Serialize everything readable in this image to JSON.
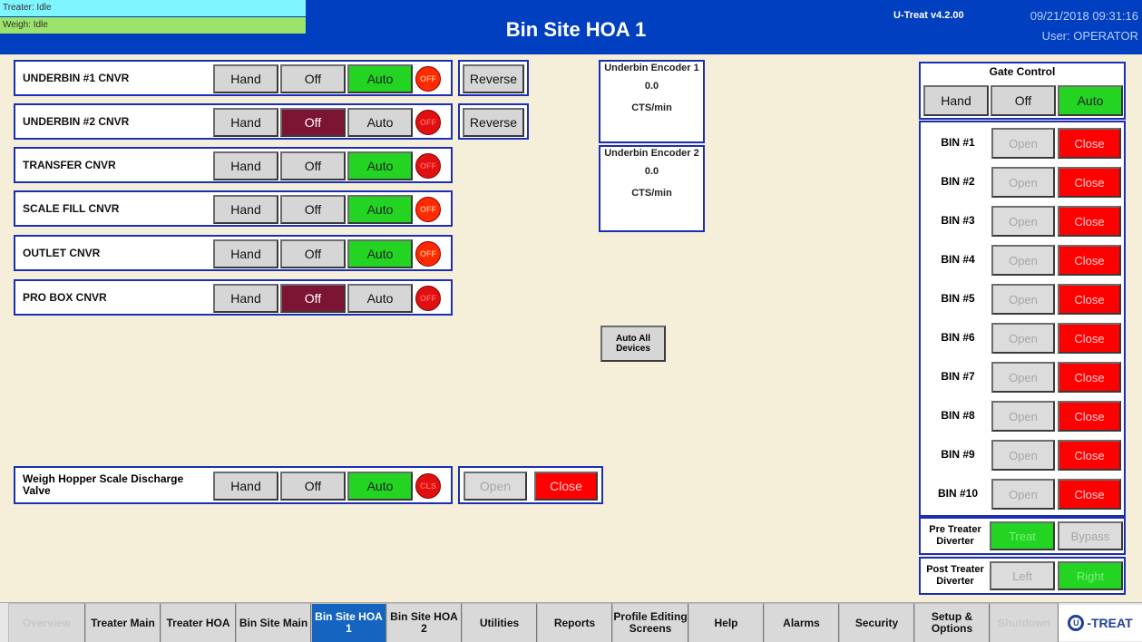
{
  "header": {
    "treater_status": "Treater: Idle",
    "weigh_status": "Weigh: Idle",
    "title": "Bin Site HOA 1",
    "version": "U-Treat v4.2.00",
    "datetime": "09/21/2018 09:31:16",
    "user": "User: OPERATOR"
  },
  "hoa_labels": {
    "hand": "Hand",
    "off": "Off",
    "auto": "Auto",
    "reverse": "Reverse"
  },
  "conveyors": [
    {
      "label": "UNDERBIN #1 CNVR",
      "state": "Auto",
      "lamp": "OFF",
      "reverse": true
    },
    {
      "label": "UNDERBIN #2 CNVR",
      "state": "Off",
      "lamp": "OFF",
      "reverse": true
    },
    {
      "label": "TRANSFER CNVR",
      "state": "Auto",
      "lamp": "OFF",
      "reverse": false
    },
    {
      "label": "SCALE FILL CNVR",
      "state": "Auto",
      "lamp": "OFF",
      "reverse": false
    },
    {
      "label": "OUTLET CNVR",
      "state": "Auto",
      "lamp": "OFF",
      "reverse": false
    },
    {
      "label": "PRO BOX CNVR",
      "state": "Off",
      "lamp": "OFF",
      "reverse": false
    }
  ],
  "encoders": [
    {
      "title": "Underbin Encoder 1",
      "value": "0.0",
      "unit": "CTS/min"
    },
    {
      "title": "Underbin Encoder 2",
      "value": "0.0",
      "unit": "CTS/min"
    }
  ],
  "auto_all": "Auto All Devices",
  "weigh_hopper": {
    "label": "Weigh Hopper Scale Discharge Valve",
    "state": "Auto",
    "lamp": "CLS",
    "open": "Open",
    "close": "Close"
  },
  "gate_control": {
    "title": "Gate Control",
    "state": "Auto",
    "bins": [
      {
        "name": "BIN #1",
        "open": "Open",
        "close": "Close"
      },
      {
        "name": "BIN #2",
        "open": "Open",
        "close": "Close"
      },
      {
        "name": "BIN #3",
        "open": "Open",
        "close": "Close"
      },
      {
        "name": "BIN #4",
        "open": "Open",
        "close": "Close"
      },
      {
        "name": "BIN #5",
        "open": "Open",
        "close": "Close"
      },
      {
        "name": "BIN #6",
        "open": "Open",
        "close": "Close"
      },
      {
        "name": "BIN #7",
        "open": "Open",
        "close": "Close"
      },
      {
        "name": "BIN #8",
        "open": "Open",
        "close": "Close"
      },
      {
        "name": "BIN #9",
        "open": "Open",
        "close": "Close"
      },
      {
        "name": "BIN #10",
        "open": "Open",
        "close": "Close"
      }
    ]
  },
  "pre_treater": {
    "label": "Pre Treater Diverter",
    "left": "Treat",
    "right": "Bypass"
  },
  "post_treater": {
    "label": "Post Treater Diverter",
    "left": "Left",
    "right": "Right"
  },
  "nav": [
    {
      "label": "Overview",
      "state": "dim"
    },
    {
      "label": "Treater Main",
      "state": "normal"
    },
    {
      "label": "Treater HOA",
      "state": "normal"
    },
    {
      "label": "Bin Site Main",
      "state": "normal"
    },
    {
      "label": "Bin Site HOA 1",
      "state": "active"
    },
    {
      "label": "Bin Site HOA 2",
      "state": "normal"
    },
    {
      "label": "Utilities",
      "state": "normal"
    },
    {
      "label": "Reports",
      "state": "normal"
    },
    {
      "label": "Profile Editing Screens",
      "state": "normal"
    },
    {
      "label": "Help",
      "state": "normal"
    },
    {
      "label": "Alarms",
      "state": "normal"
    },
    {
      "label": "Security",
      "state": "normal"
    },
    {
      "label": "Setup & Options",
      "state": "normal"
    },
    {
      "label": "Shutdown",
      "state": "dim"
    }
  ],
  "logo": "-TREAT",
  "colors": {
    "header_bg": "#003fbf",
    "auto_green": "#23d423",
    "off_maroon": "#7c1433",
    "close_red": "#ff0000",
    "active_tab": "#1565c0"
  }
}
